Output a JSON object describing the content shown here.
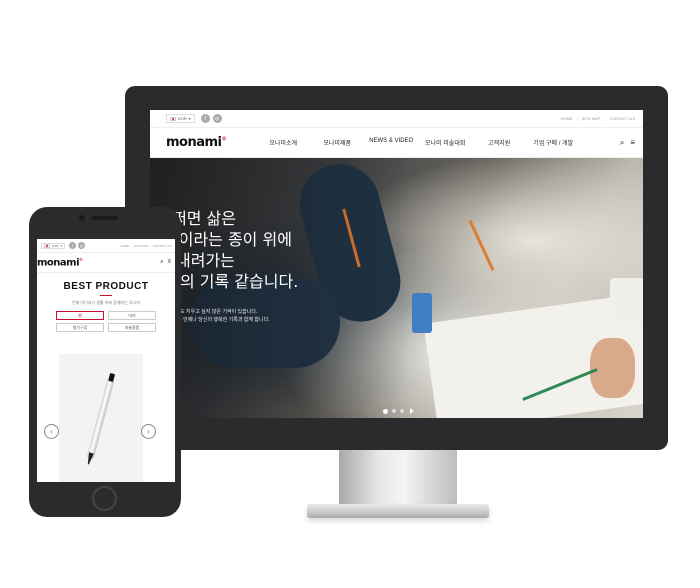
{
  "desktop": {
    "topbar": {
      "language": "KOR",
      "social": [
        {
          "icon": "facebook-icon",
          "glyph": "f"
        },
        {
          "icon": "instagram-icon",
          "glyph": "◎"
        }
      ],
      "links": [
        "HOME",
        "SITE MAP",
        "CONTACT US"
      ]
    },
    "logo": "monami",
    "logo_mark": "®",
    "menu": [
      "모나미소개",
      "모나미제품",
      "NEWS & VIDEO",
      "모나미 미술대회",
      "고객지원",
      "기업 구매 / 개발"
    ],
    "icons": {
      "search": "⌕",
      "menu": "≡"
    },
    "hero": {
      "lines": [
        "쩌면 삶은",
        "생이라는 종이 위에",
        "내려가는",
        "의 기록 같습니다."
      ],
      "sub_lines": [
        "도 지우고 싶지 않은 기억이 있습니다.",
        "- 언제나 당신의 행복한 기록과 함께 합니다."
      ]
    }
  },
  "mobile": {
    "topbar": {
      "language": "KOR",
      "social": [
        {
          "icon": "facebook-icon",
          "glyph": "f"
        },
        {
          "icon": "instagram-icon",
          "glyph": "◎"
        }
      ],
      "links": [
        "HOME",
        "SITE MAP",
        "CONTACT US"
      ]
    },
    "logo": "monami",
    "logo_mark": "®",
    "icons": {
      "search": "⌕",
      "menu": "≡"
    },
    "title": "BEST PRODUCT",
    "description": "언제 어디서나 생활 속에 함께하는 모나미",
    "filters": [
      {
        "label": "펜",
        "active": true
      },
      {
        "label": "마커",
        "active": false
      },
      {
        "label": "필기구류",
        "active": false
      },
      {
        "label": "미술용품",
        "active": false
      }
    ],
    "arrows": {
      "prev": "‹",
      "next": "›"
    }
  },
  "colors": {
    "accent": "#c8102e",
    "device": "#2b2b2b"
  }
}
